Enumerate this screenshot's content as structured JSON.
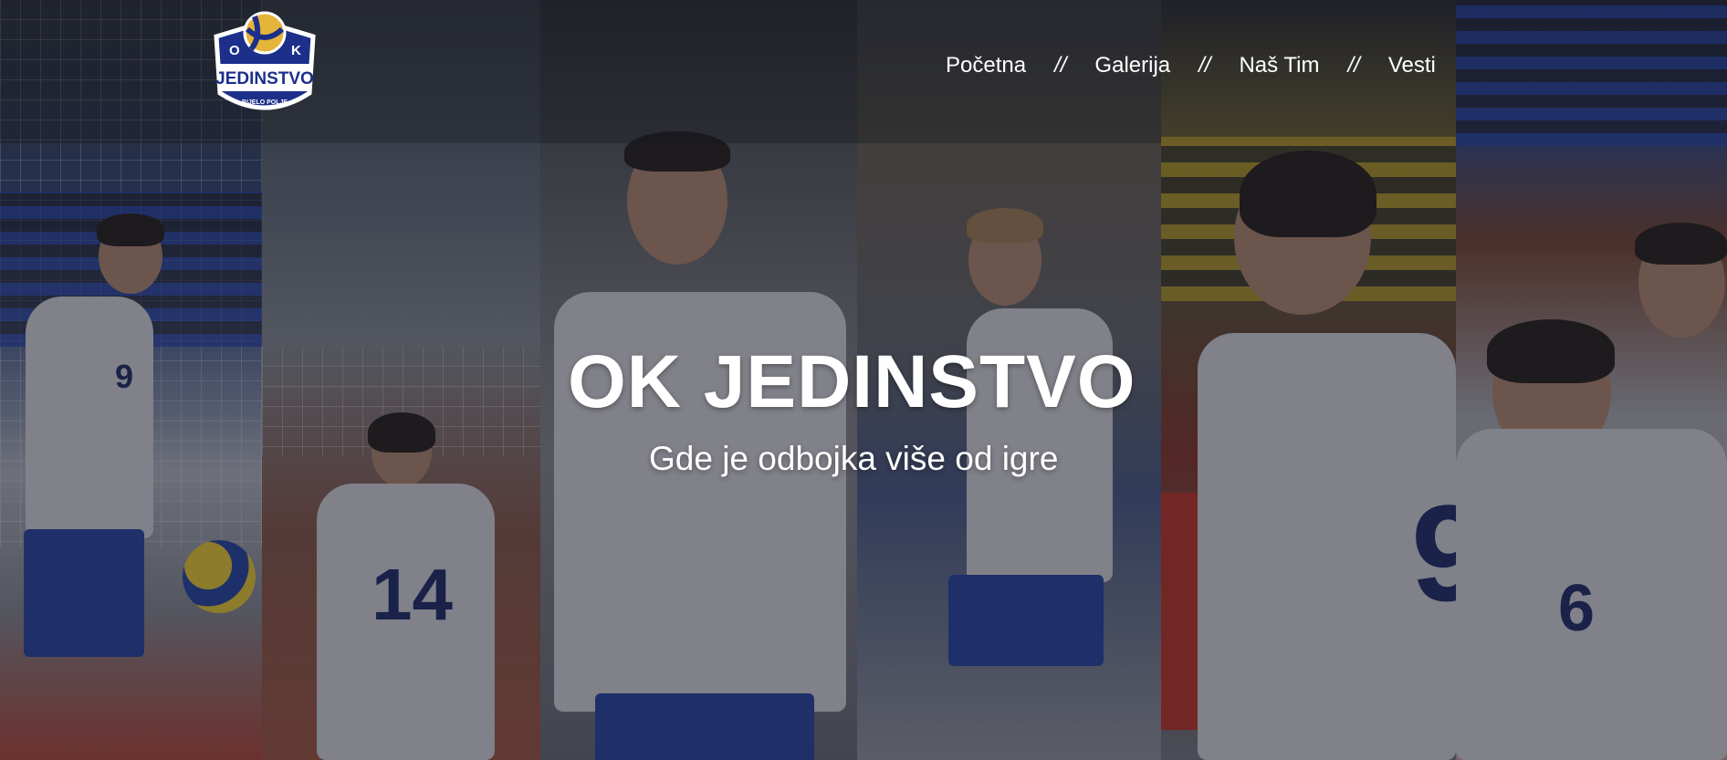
{
  "brand": {
    "logo_letters": [
      "O",
      "K"
    ],
    "logo_name": "JEDINSTVO",
    "logo_place": "BIJELO POLJE",
    "colors": {
      "logo_navy": "#1c2f8a",
      "logo_gold": "#e5b43a",
      "jersey_blue": "#2d47a8"
    }
  },
  "nav": {
    "items": [
      {
        "label": "Početna"
      },
      {
        "label": "Galerija"
      },
      {
        "label": "Naš Tim"
      },
      {
        "label": "Vesti"
      }
    ],
    "separator": "//"
  },
  "hero": {
    "title": "OK JEDINSTVO",
    "subtitle": "Gde je odbojka više od igre"
  }
}
